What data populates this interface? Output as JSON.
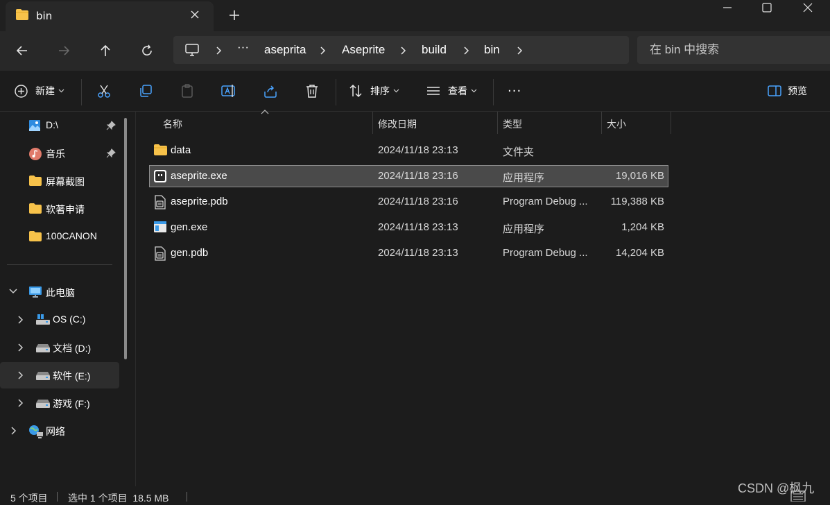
{
  "window": {
    "tab_title": "bin",
    "controls": [
      "minimize",
      "maximize",
      "close"
    ]
  },
  "address": {
    "crumbs": [
      "aseprita",
      "Aseprite",
      "build",
      "bin"
    ],
    "overflow": "···"
  },
  "search": {
    "placeholder": "在 bin 中搜索"
  },
  "toolbar": {
    "new_label": "新建",
    "sort_label": "排序",
    "view_label": "查看",
    "more_label": "···",
    "preview_label": "预览"
  },
  "sidebar": {
    "quick_access": [
      {
        "label": "D:\\",
        "icon": "image-icon",
        "pinned": true
      },
      {
        "label": "音乐",
        "icon": "music-icon",
        "pinned": true
      },
      {
        "label": "屏幕截图",
        "icon": "folder-icon",
        "pinned": false
      },
      {
        "label": "软著申请",
        "icon": "folder-icon",
        "pinned": false
      },
      {
        "label": "100CANON",
        "icon": "folder-icon",
        "pinned": false
      }
    ],
    "this_pc": "此电脑",
    "drives": [
      {
        "label": "OS (C:)",
        "icon": "system-drive-icon"
      },
      {
        "label": "文档 (D:)",
        "icon": "drive-icon"
      },
      {
        "label": "软件 (E:)",
        "icon": "drive-icon",
        "highlighted": true
      },
      {
        "label": "游戏 (F:)",
        "icon": "drive-icon"
      }
    ],
    "network": "网络"
  },
  "columns": {
    "name": "名称",
    "date": "修改日期",
    "type": "类型",
    "size": "大小"
  },
  "files": [
    {
      "name": "data",
      "date": "2024/11/18 23:13",
      "type": "文件夹",
      "size": "",
      "icon": "folder-icon",
      "selected": false
    },
    {
      "name": "aseprite.exe",
      "date": "2024/11/18 23:16",
      "type": "应用程序",
      "size": "19,016 KB",
      "icon": "app-icon",
      "selected": true
    },
    {
      "name": "aseprite.pdb",
      "date": "2024/11/18 23:16",
      "type": "Program Debug ...",
      "size": "119,388 KB",
      "icon": "debug-file-icon",
      "selected": false
    },
    {
      "name": "gen.exe",
      "date": "2024/11/18 23:13",
      "type": "应用程序",
      "size": "1,204 KB",
      "icon": "exe-icon",
      "selected": false
    },
    {
      "name": "gen.pdb",
      "date": "2024/11/18 23:13",
      "type": "Program Debug ...",
      "size": "14,204 KB",
      "icon": "debug-file-icon",
      "selected": false
    }
  ],
  "status": {
    "count": "5 个项目",
    "selection": "选中 1 个项目  18.5 MB"
  },
  "watermark": "CSDN @枫九",
  "colors": {
    "background": "#1c1c1c",
    "titlebar": "#202020",
    "accent_folder": "#f7c24a",
    "accent_blue": "#4aa3ff",
    "selected_row": "#4a4a4a"
  }
}
